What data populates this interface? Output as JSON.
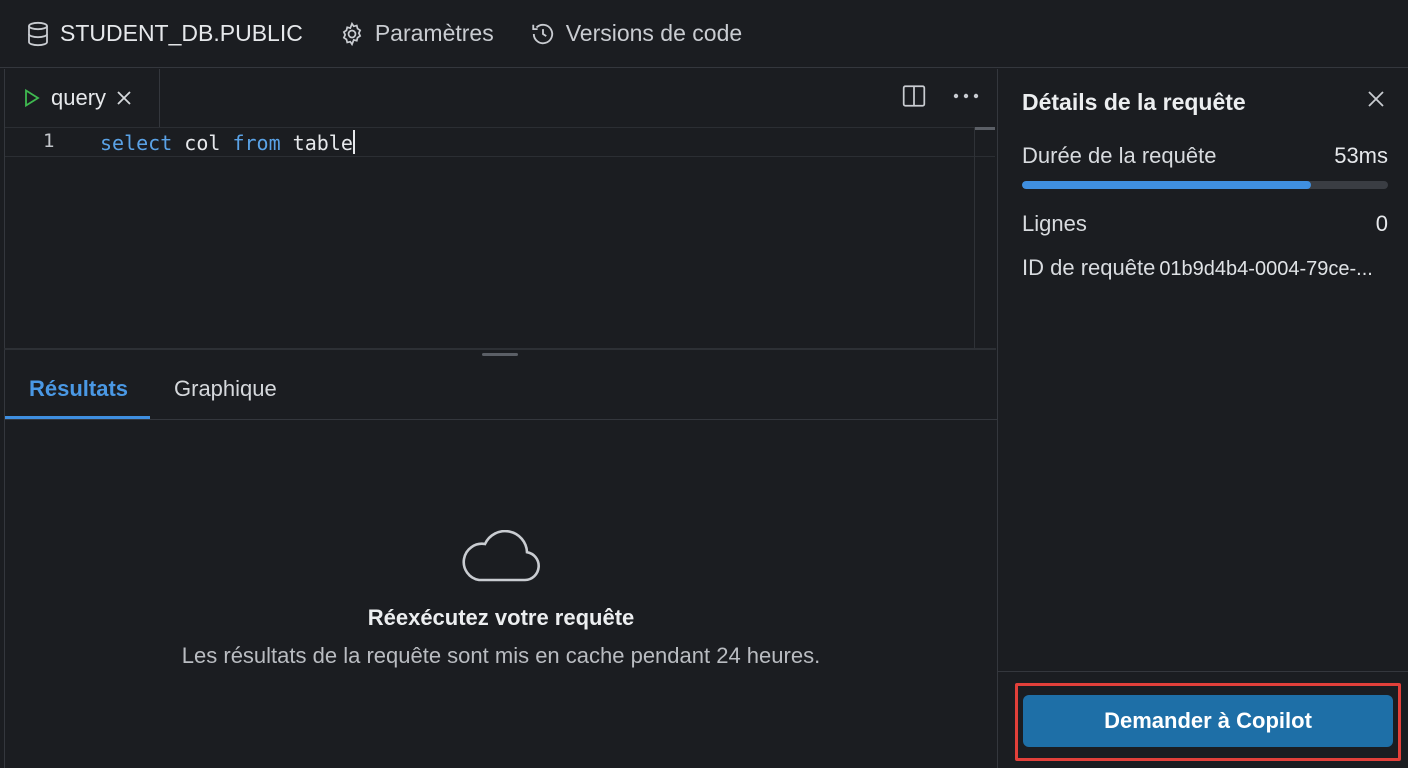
{
  "topbar": {
    "db_label": "STUDENT_DB.PUBLIC",
    "settings_label": "Paramètres",
    "versions_label": "Versions de code"
  },
  "editor": {
    "tab_label": "query",
    "line_number": "1",
    "code_keyword_1": "select",
    "code_text_1": " col ",
    "code_keyword_2": "from",
    "code_text_2": " table"
  },
  "results": {
    "tabs": [
      "Résultats",
      "Graphique"
    ],
    "active_tab": "Résultats",
    "empty_title": "Réexécutez votre requête",
    "empty_subtitle": "Les résultats de la requête sont mis en cache pendant 24 heures."
  },
  "details": {
    "title": "Détails de la requête",
    "duration_label": "Durée de la requête",
    "duration_value": "53ms",
    "duration_progress": 0.79,
    "rows_label": "Lignes",
    "rows_value": "0",
    "id_label": "ID de requête",
    "id_value": "01b9d4b4-0004-79ce-...",
    "copilot_button": "Demander à Copilot"
  },
  "icons": [
    "database-icon",
    "gear-icon",
    "history-icon",
    "play-icon",
    "close-icon",
    "split-view-icon",
    "more-icon",
    "cloud-icon"
  ],
  "colors": {
    "background": "#1b1d21",
    "accent": "#3f8fe0",
    "copilot_button": "#1e6fa7",
    "highlight_border": "#e2403a",
    "keyword": "#5aa2e6",
    "run_green": "#3fb950"
  }
}
